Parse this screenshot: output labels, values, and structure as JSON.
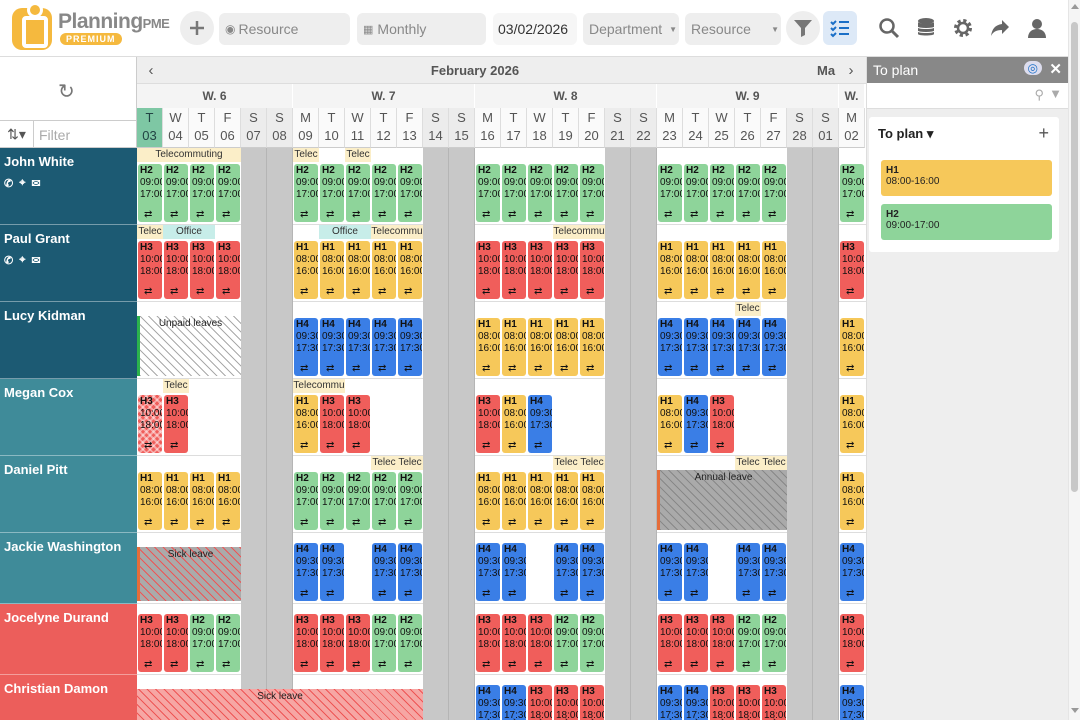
{
  "app": {
    "name": "Planning",
    "name_suffix": "PME",
    "badge": "PREMIUM"
  },
  "toolbar": {
    "resource_placeholder": "Resource",
    "view_mode": "Monthly",
    "date": "03/02/2026",
    "department_label": "Department",
    "resource_label": "Resource"
  },
  "grid": {
    "filter_placeholder": "Filter",
    "month_title": "February 2026",
    "next_month": "Ma",
    "weeks": [
      {
        "label": "W. 6"
      },
      {
        "label": "W. 7"
      },
      {
        "label": "W. 8"
      },
      {
        "label": "W. 9"
      },
      {
        "label": "W."
      }
    ],
    "days": [
      {
        "l": "T",
        "n": "03"
      },
      {
        "l": "W",
        "n": "04"
      },
      {
        "l": "T",
        "n": "05"
      },
      {
        "l": "F",
        "n": "06"
      },
      {
        "l": "S",
        "n": "07"
      },
      {
        "l": "S",
        "n": "08"
      },
      {
        "l": "M",
        "n": "09"
      },
      {
        "l": "T",
        "n": "10"
      },
      {
        "l": "W",
        "n": "11"
      },
      {
        "l": "T",
        "n": "12"
      },
      {
        "l": "F",
        "n": "13"
      },
      {
        "l": "S",
        "n": "14"
      },
      {
        "l": "S",
        "n": "15"
      },
      {
        "l": "M",
        "n": "16"
      },
      {
        "l": "T",
        "n": "17"
      },
      {
        "l": "W",
        "n": "18"
      },
      {
        "l": "T",
        "n": "19"
      },
      {
        "l": "F",
        "n": "20"
      },
      {
        "l": "S",
        "n": "21"
      },
      {
        "l": "S",
        "n": "22"
      },
      {
        "l": "M",
        "n": "23"
      },
      {
        "l": "T",
        "n": "24"
      },
      {
        "l": "W",
        "n": "25"
      },
      {
        "l": "T",
        "n": "26"
      },
      {
        "l": "F",
        "n": "27"
      },
      {
        "l": "S",
        "n": "28"
      },
      {
        "l": "S",
        "n": "01"
      },
      {
        "l": "M",
        "n": "02"
      }
    ]
  },
  "resources": [
    {
      "name": "John White",
      "color": "#1c5a73",
      "icons": true
    },
    {
      "name": "Paul Grant",
      "color": "#1c5a73",
      "icons": true
    },
    {
      "name": "Lucy Kidman",
      "color": "#1c5a73"
    },
    {
      "name": "Megan Cox",
      "color": "#3f8b99"
    },
    {
      "name": "Daniel Pitt",
      "color": "#3f8b99"
    },
    {
      "name": "Jackie Washington",
      "color": "#3f8b99"
    },
    {
      "name": "Jocelyne Durand",
      "color": "#ec5e5b"
    },
    {
      "name": "Christian Damon",
      "color": "#ec5e5b"
    }
  ],
  "tasks": {
    "H1": {
      "code": "H1",
      "t1": "08:00",
      "t2": "16:00",
      "color": "#f6c85a"
    },
    "H2": {
      "code": "H2",
      "t1": "09:00",
      "t2": "17:00",
      "color": "#8ed49a"
    },
    "H3": {
      "code": "H3",
      "t1": "10:00",
      "t2": "18:00",
      "color": "#f05e5b"
    },
    "H4": {
      "code": "H4",
      "t1": "09:30",
      "t2": "17:30",
      "color": "#3a7ee6"
    }
  },
  "bands": {
    "telecommuting": "Telecommuting",
    "telec": "Telec",
    "telecommu": "Telecommu",
    "office": "Office",
    "unpaid": "Unpaid leaves",
    "sick": "Sick leave",
    "annual": "Annual leave"
  },
  "panel": {
    "title": "To plan",
    "list_title": "To plan",
    "items": [
      {
        "code": "H1",
        "hours": "08:00-16:00",
        "color": "#f6c85a"
      },
      {
        "code": "H2",
        "hours": "09:00-17:00",
        "color": "#8ed49a"
      }
    ]
  }
}
